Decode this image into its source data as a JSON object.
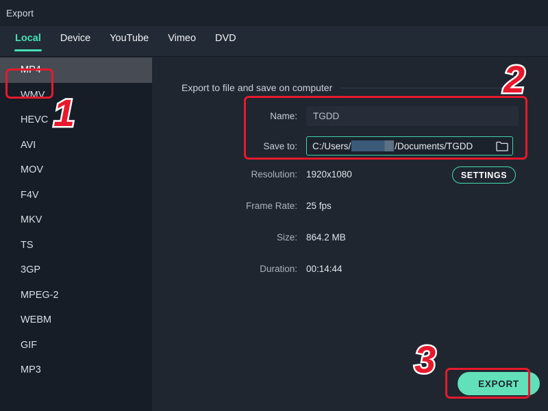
{
  "window": {
    "title": "Export"
  },
  "tabs": {
    "items": [
      {
        "label": "Local",
        "active": true
      },
      {
        "label": "Device",
        "active": false
      },
      {
        "label": "YouTube",
        "active": false
      },
      {
        "label": "Vimeo",
        "active": false
      },
      {
        "label": "DVD",
        "active": false
      }
    ]
  },
  "sidebar": {
    "formats": [
      {
        "label": "MP4",
        "selected": true
      },
      {
        "label": "WMV",
        "selected": false
      },
      {
        "label": "HEVC",
        "selected": false
      },
      {
        "label": "AVI",
        "selected": false
      },
      {
        "label": "MOV",
        "selected": false
      },
      {
        "label": "F4V",
        "selected": false
      },
      {
        "label": "MKV",
        "selected": false
      },
      {
        "label": "TS",
        "selected": false
      },
      {
        "label": "3GP",
        "selected": false
      },
      {
        "label": "MPEG-2",
        "selected": false
      },
      {
        "label": "WEBM",
        "selected": false
      },
      {
        "label": "GIF",
        "selected": false
      },
      {
        "label": "MP3",
        "selected": false
      }
    ]
  },
  "main": {
    "section_title": "Export to file and save on computer",
    "name_label": "Name:",
    "name_value": "TGDD",
    "name_placeholder": "TGDD",
    "save_label": "Save to:",
    "save_path_prefix": "C:/Users/",
    "save_path_suffix": "/Documents/TGDD",
    "folder_icon": "folder-icon",
    "details": [
      {
        "label": "Resolution:",
        "value": "1920x1080"
      },
      {
        "label": "Frame Rate:",
        "value": "25 fps"
      },
      {
        "label": "Size:",
        "value": "864.2 MB"
      },
      {
        "label": "Duration:",
        "value": "00:14:44"
      }
    ],
    "settings_label": "SETTINGS",
    "export_label": "EXPORT"
  },
  "annotations": {
    "step1": "1",
    "step2": "2",
    "step3": "3"
  },
  "colors": {
    "accent": "#47e0b4",
    "export_fill": "#62e0b9",
    "annotation_red": "#e8192c",
    "sidebar_bg": "#161d26",
    "main_bg": "#1f2630",
    "titlebar_bg": "#1b222c"
  }
}
